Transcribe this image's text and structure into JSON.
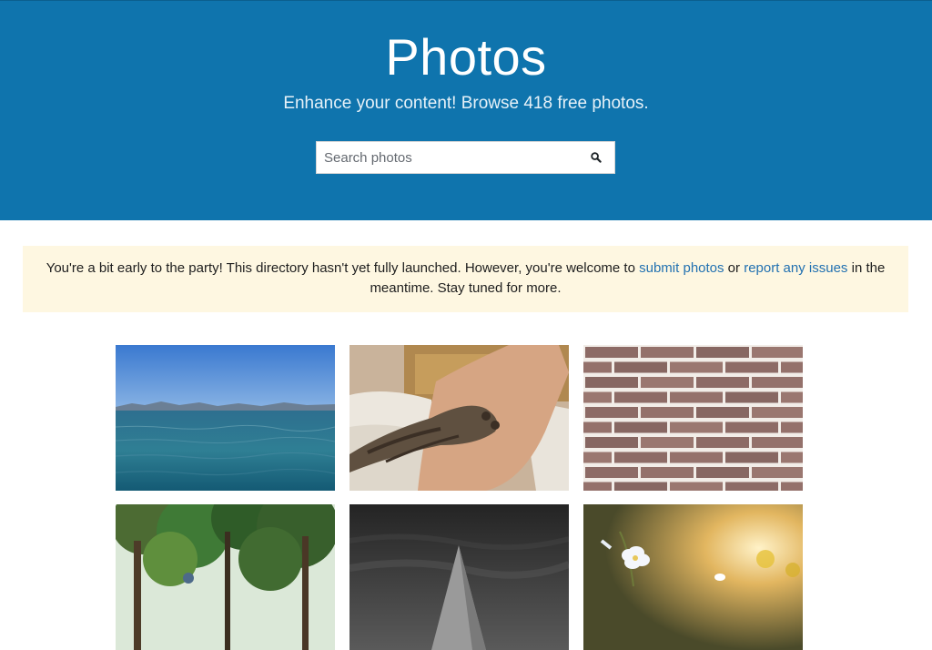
{
  "header": {
    "title": "Photos",
    "subtitle": "Enhance your content! Browse 418 free photos."
  },
  "search": {
    "placeholder": "Search photos",
    "value": "",
    "icon": "search-icon"
  },
  "notice": {
    "text_before": "You're a bit early to the party! This directory hasn't yet fully launched. However, you're welcome to ",
    "link1": "submit photos",
    "text_between": " or ",
    "link2": "report any issues",
    "text_after": " in the meantime. Stay tuned for more."
  },
  "colors": {
    "header_bg": "#0f74ad",
    "notice_bg": "#fef7e1",
    "link": "#2271b1"
  },
  "photos": [
    {
      "subject": "lake-with-mountains"
    },
    {
      "subject": "cat-paw-on-arm"
    },
    {
      "subject": "brick-wall"
    },
    {
      "subject": "forest-trees"
    },
    {
      "subject": "pyramid-dark"
    },
    {
      "subject": "white-flowers-sunset"
    }
  ]
}
